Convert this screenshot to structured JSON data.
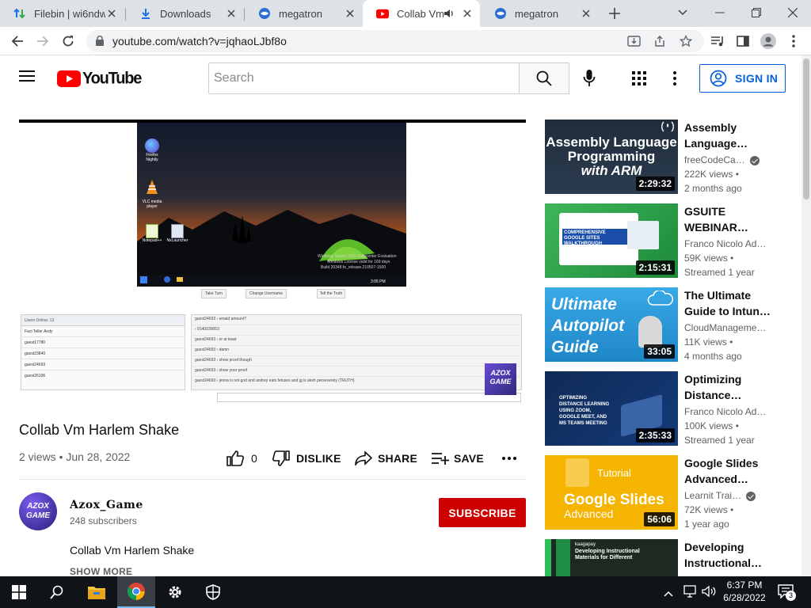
{
  "browser": {
    "tabs": [
      {
        "label": "Filebin | wi6ndw",
        "icon": "filebin-icon"
      },
      {
        "label": "Downloads",
        "icon": "download-icon"
      },
      {
        "label": "megatron",
        "icon": "megatron-icon"
      },
      {
        "label": "Collab Vm H",
        "icon": "youtube-icon",
        "active": true
      },
      {
        "label": "megatron",
        "icon": "megatron-icon"
      }
    ],
    "url": "youtube.com/watch?v=jqhaoLJbf8o"
  },
  "youtube": {
    "logo_text": "YouTube",
    "search_placeholder": "Search",
    "signin_label": "SIGN IN"
  },
  "player": {
    "desktop_icons": [
      "Firefox Nightly",
      "VLC media player",
      "Notepad++",
      "NxLauncher"
    ],
    "watermark": [
      "Windows Server 2022 Datacenter Evaluation",
      "Windows License valid for 169 days",
      "Build 20348.fe_release.210507-1500"
    ],
    "taskbar_time": "3:05 PM",
    "buttons": [
      "Take Turn",
      "Change Username",
      "Tell the Truth"
    ],
    "users_header": "Users Online: 13",
    "users": [
      "Fact Teller Andy",
      "guest17780",
      "guest23840",
      "guest24693",
      "guest26106"
    ],
    "chat": [
      "guest24693 › emaid amount?",
      "› 9140030053",
      "guest24693 › or at least",
      "guest24693 › damn",
      "guest24693 › show proof though",
      "guest24693 › show your proof",
      "guest24693 › jenna is not god and andrey eats fetuses and jg is aksh perseverely (TRUTH)"
    ],
    "overlay_logo": "AZOX GAME"
  },
  "video": {
    "title": "Collab Vm Harlem Shake",
    "views": "2 views",
    "date": "Jun 28, 2022",
    "likes": "0",
    "dislike_label": "DISLIKE",
    "share_label": "SHARE",
    "save_label": "SAVE",
    "channel_name": "Azox_Game",
    "channel_avatar_text": "AZOX GAME",
    "subscribers": "248 subscribers",
    "subscribe_label": "SUBSCRIBE",
    "description": "Collab Vm Harlem Shake",
    "show_more": "SHOW MORE"
  },
  "recommendations": [
    {
      "title1": "Assembly",
      "title2": "Language…",
      "channel": "freeCodeCa…",
      "verified": true,
      "views": "222K views",
      "age": "2 months ago",
      "duration": "2:29:32",
      "thumb_text": [
        "Assembly Language",
        "Programming",
        "with ARM"
      ],
      "thumb_color": "#1f2c3a"
    },
    {
      "title1": "GSUITE",
      "title2": "WEBINAR…",
      "channel": "Franco Nicolo Ad…",
      "verified": false,
      "views": "59K views",
      "age": "Streamed 1 year",
      "duration": "2:15:31",
      "thumb_text": [
        "COMPREHENSIVE",
        "GOOGLE SITES",
        "WALKTHROUGH"
      ],
      "thumb_color": "#2e9e4a"
    },
    {
      "title1": "The Ultimate",
      "title2": "Guide to Intun…",
      "channel": "CloudManageme…",
      "verified": false,
      "views": "11K views",
      "age": "4 months ago",
      "duration": "33:05",
      "thumb_text": [
        "Ultimate",
        "Autopilot",
        "Guide"
      ],
      "thumb_color": "#2aa1e0"
    },
    {
      "title1": "Optimizing",
      "title2": "Distance…",
      "channel": "Franco Nicolo Ad…",
      "verified": false,
      "views": "100K views",
      "age": "Streamed 1 year",
      "duration": "2:35:33",
      "thumb_text": [
        "OPTIMIZING",
        "DISTANCE LEARNING",
        "USING ZOOM,",
        "GOOGLE MEET, AND",
        "MS TEAMS MEETING"
      ],
      "thumb_color": "#0f2a56"
    },
    {
      "title1": "Google Slides",
      "title2": "Advanced…",
      "channel": "Learnit Trai…",
      "verified": true,
      "views": "72K views",
      "age": "1 year ago",
      "duration": "56:06",
      "thumb_text": [
        "Tutorial",
        "Google Slides",
        "Advanced"
      ],
      "thumb_color": "#f4b400"
    },
    {
      "title1": "Developing",
      "title2": "Instructional…",
      "channel": "",
      "verified": false,
      "views": "",
      "age": "",
      "duration": "",
      "thumb_text": [
        "kaagapay",
        "Developing Instructional",
        "Materials for Different"
      ],
      "thumb_color": "#1d2a22"
    }
  ],
  "taskbar": {
    "time": "6:37 PM",
    "date": "6/28/2022",
    "notifications": "3"
  }
}
